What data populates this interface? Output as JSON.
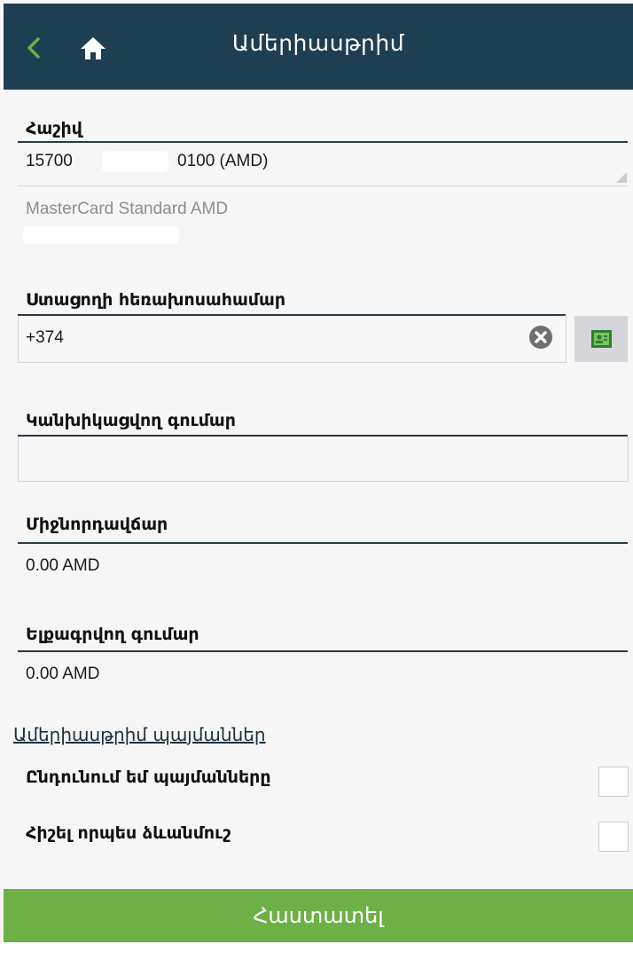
{
  "header": {
    "title": "Ամերիասթրիմ",
    "back_icon": "chevron-left-icon",
    "home_icon": "home-icon",
    "background": "#1e3e52",
    "accent": "#6cb046"
  },
  "account": {
    "label": "Հաշիվ",
    "value_prefix": "15700",
    "value_suffix": "0100 (AMD)",
    "card_name": "MasterCard Standard AMD"
  },
  "recipient_phone": {
    "label": "Ստացողի հեռախոսահամար",
    "value": "+374",
    "clear_icon": "clear-icon",
    "contacts_icon": "contacts-icon"
  },
  "prepaid_amount": {
    "label": "Կանխիկացվող գումար",
    "value": ""
  },
  "fee": {
    "label": "Միջնորդավճար",
    "value": "0.00 AMD"
  },
  "debited_amount": {
    "label": "Ելքագրվող գումար",
    "value": "0.00 AMD"
  },
  "terms": {
    "link_text": "Ամերիասթրիմ պայմաններ",
    "accept_label": "Ընդունում եմ պայմանները",
    "save_template_label": "Հիշել որպես ձևանմուշ"
  },
  "confirm": {
    "label": "Հաստատել",
    "color": "#6cb046"
  }
}
